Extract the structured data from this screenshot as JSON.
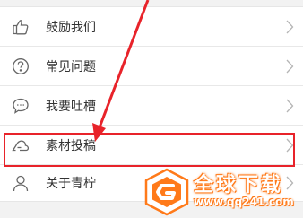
{
  "menu": {
    "items": [
      {
        "label": "鼓励我们",
        "icon": "thumbs-up-icon"
      },
      {
        "label": "常见问题",
        "icon": "question-circle-icon"
      },
      {
        "label": "我要吐槽",
        "icon": "chat-bubble-icon"
      },
      {
        "label": "素材投稿",
        "icon": "submit-cloud-icon"
      },
      {
        "label": "关于青柠",
        "icon": "person-icon"
      }
    ]
  },
  "annotation": {
    "color": "#e8232a",
    "highlighted_item": "素材投稿"
  },
  "watermark": {
    "title": "全球下载",
    "url": "www.qq241.com",
    "color": "#ff7a1a"
  }
}
